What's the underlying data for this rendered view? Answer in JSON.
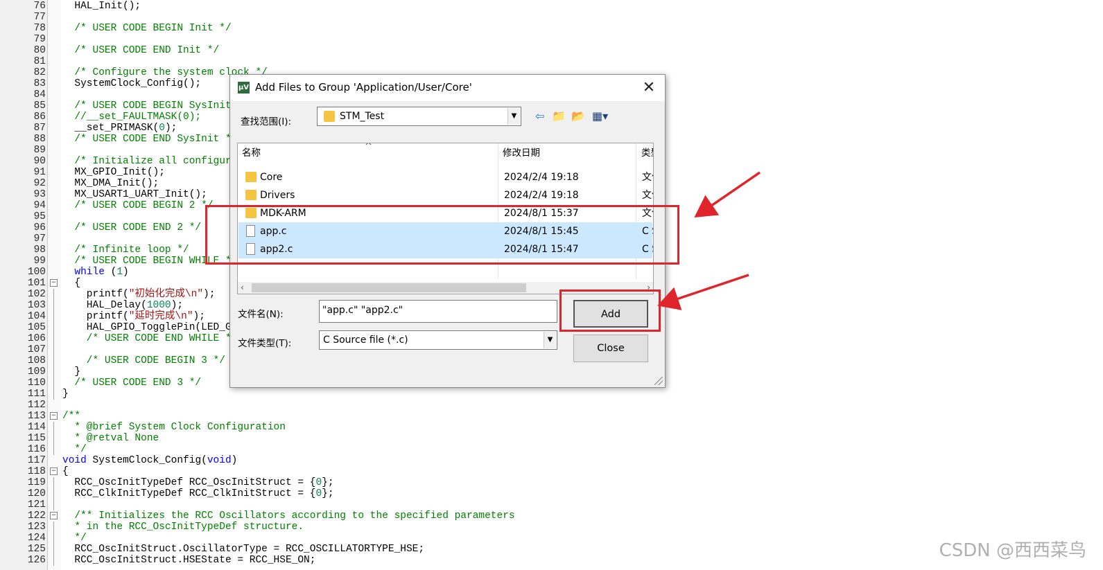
{
  "editor": {
    "lines": [
      {
        "n": "76",
        "fold": "",
        "segs": [
          {
            "t": "  HAL_Init();",
            "c": ""
          }
        ]
      },
      {
        "n": "77",
        "fold": "",
        "segs": []
      },
      {
        "n": "78",
        "fold": "",
        "segs": [
          {
            "t": "  /* USER CODE BEGIN Init */",
            "c": "cm"
          }
        ]
      },
      {
        "n": "79",
        "fold": "",
        "segs": []
      },
      {
        "n": "80",
        "fold": "",
        "segs": [
          {
            "t": "  /* USER CODE END Init */",
            "c": "cm"
          }
        ]
      },
      {
        "n": "81",
        "fold": "",
        "segs": []
      },
      {
        "n": "82",
        "fold": "",
        "segs": [
          {
            "t": "  /* Configure the system clock */",
            "c": "cm"
          }
        ]
      },
      {
        "n": "83",
        "fold": "",
        "segs": [
          {
            "t": "  SystemClock_Config();",
            "c": ""
          }
        ]
      },
      {
        "n": "84",
        "fold": "",
        "segs": []
      },
      {
        "n": "85",
        "fold": "",
        "segs": [
          {
            "t": "  /* USER CODE BEGIN SysInit */",
            "c": "cm"
          }
        ]
      },
      {
        "n": "86",
        "fold": "",
        "segs": [
          {
            "t": "  //__set_FAULTMASK(0);",
            "c": "cm"
          }
        ]
      },
      {
        "n": "87",
        "fold": "",
        "segs": [
          {
            "t": "  __set_PRIMASK(",
            "c": ""
          },
          {
            "t": "0",
            "c": "num"
          },
          {
            "t": ");",
            "c": ""
          }
        ]
      },
      {
        "n": "88",
        "fold": "",
        "segs": [
          {
            "t": "  /* USER CODE END SysInit */",
            "c": "cm"
          }
        ]
      },
      {
        "n": "89",
        "fold": "",
        "segs": []
      },
      {
        "n": "90",
        "fold": "",
        "segs": [
          {
            "t": "  /* Initialize all configured peripherals */",
            "c": "cm"
          }
        ]
      },
      {
        "n": "91",
        "fold": "",
        "segs": [
          {
            "t": "  MX_GPIO_Init();",
            "c": ""
          }
        ]
      },
      {
        "n": "92",
        "fold": "",
        "segs": [
          {
            "t": "  MX_DMA_Init();",
            "c": ""
          }
        ]
      },
      {
        "n": "93",
        "fold": "",
        "segs": [
          {
            "t": "  MX_USART1_UART_Init();",
            "c": ""
          }
        ]
      },
      {
        "n": "94",
        "fold": "",
        "segs": [
          {
            "t": "  /* USER CODE BEGIN 2 */",
            "c": "cm"
          }
        ]
      },
      {
        "n": "95",
        "fold": "",
        "segs": []
      },
      {
        "n": "96",
        "fold": "",
        "segs": [
          {
            "t": "  /* USER CODE END 2 */",
            "c": "cm"
          }
        ]
      },
      {
        "n": "97",
        "fold": "",
        "segs": []
      },
      {
        "n": "98",
        "fold": "",
        "segs": [
          {
            "t": "  /* Infinite loop */",
            "c": "cm"
          }
        ]
      },
      {
        "n": "99",
        "fold": "",
        "segs": [
          {
            "t": "  /* USER CODE BEGIN WHILE */",
            "c": "cm"
          }
        ]
      },
      {
        "n": "100",
        "fold": "",
        "segs": [
          {
            "t": "  ",
            "c": ""
          },
          {
            "t": "while",
            "c": "kw"
          },
          {
            "t": " (",
            "c": ""
          },
          {
            "t": "1",
            "c": "num"
          },
          {
            "t": ")",
            "c": ""
          }
        ]
      },
      {
        "n": "101",
        "fold": "box",
        "segs": [
          {
            "t": "  {",
            "c": ""
          }
        ]
      },
      {
        "n": "102",
        "fold": "line",
        "segs": [
          {
            "t": "    printf(",
            "c": ""
          },
          {
            "t": "\"初始化完成\\n\"",
            "c": "str"
          },
          {
            "t": ");",
            "c": ""
          }
        ]
      },
      {
        "n": "103",
        "fold": "line",
        "segs": [
          {
            "t": "    HAL_Delay(",
            "c": ""
          },
          {
            "t": "1000",
            "c": "num"
          },
          {
            "t": ");",
            "c": ""
          }
        ]
      },
      {
        "n": "104",
        "fold": "line",
        "segs": [
          {
            "t": "    printf(",
            "c": ""
          },
          {
            "t": "\"延时完成\\n\"",
            "c": "str"
          },
          {
            "t": ");",
            "c": ""
          }
        ]
      },
      {
        "n": "105",
        "fold": "line",
        "segs": [
          {
            "t": "    HAL_GPIO_TogglePin(LED_GPIO_Port, LED_Pin);",
            "c": ""
          }
        ]
      },
      {
        "n": "106",
        "fold": "line",
        "segs": [
          {
            "t": "    /* USER CODE END WHILE */",
            "c": "cm"
          }
        ]
      },
      {
        "n": "107",
        "fold": "line",
        "segs": []
      },
      {
        "n": "108",
        "fold": "line",
        "segs": [
          {
            "t": "    /* USER CODE BEGIN 3 */",
            "c": "cm"
          }
        ]
      },
      {
        "n": "109",
        "fold": "line",
        "segs": [
          {
            "t": "  }",
            "c": ""
          }
        ]
      },
      {
        "n": "110",
        "fold": "line",
        "segs": [
          {
            "t": "  /* USER CODE END 3 */",
            "c": "cm"
          }
        ]
      },
      {
        "n": "111",
        "fold": "line",
        "segs": [
          {
            "t": "}",
            "c": ""
          }
        ]
      },
      {
        "n": "112",
        "fold": "",
        "segs": []
      },
      {
        "n": "113",
        "fold": "box",
        "segs": [
          {
            "t": "/**",
            "c": "cm"
          }
        ]
      },
      {
        "n": "114",
        "fold": "line",
        "segs": [
          {
            "t": "  * @brief System Clock Configuration",
            "c": "cm"
          }
        ]
      },
      {
        "n": "115",
        "fold": "line",
        "segs": [
          {
            "t": "  * @retval None",
            "c": "cm"
          }
        ]
      },
      {
        "n": "116",
        "fold": "line",
        "segs": [
          {
            "t": "  */",
            "c": "cm"
          }
        ]
      },
      {
        "n": "117",
        "fold": "",
        "segs": [
          {
            "t": "void",
            "c": "kw"
          },
          {
            "t": " SystemClock_Config(",
            "c": ""
          },
          {
            "t": "void",
            "c": "kw"
          },
          {
            "t": ")",
            "c": ""
          }
        ]
      },
      {
        "n": "118",
        "fold": "box",
        "segs": [
          {
            "t": "{",
            "c": ""
          }
        ]
      },
      {
        "n": "119",
        "fold": "line",
        "segs": [
          {
            "t": "  RCC_OscInitTypeDef RCC_OscInitStruct = {",
            "c": ""
          },
          {
            "t": "0",
            "c": "num"
          },
          {
            "t": "};",
            "c": ""
          }
        ]
      },
      {
        "n": "120",
        "fold": "line",
        "segs": [
          {
            "t": "  RCC_ClkInitTypeDef RCC_ClkInitStruct = {",
            "c": ""
          },
          {
            "t": "0",
            "c": "num"
          },
          {
            "t": "};",
            "c": ""
          }
        ]
      },
      {
        "n": "121",
        "fold": "line",
        "segs": []
      },
      {
        "n": "122",
        "fold": "box",
        "segs": [
          {
            "t": "  /** Initializes the RCC Oscillators according to the specified parameters",
            "c": "cm"
          }
        ]
      },
      {
        "n": "123",
        "fold": "line",
        "segs": [
          {
            "t": "  * in the RCC_OscInitTypeDef structure.",
            "c": "cm"
          }
        ]
      },
      {
        "n": "124",
        "fold": "line",
        "segs": [
          {
            "t": "  */",
            "c": "cm"
          }
        ]
      },
      {
        "n": "125",
        "fold": "line",
        "segs": [
          {
            "t": "  RCC_OscInitStruct.OscillatorType = RCC_OSCILLATORTYPE_HSE;",
            "c": ""
          }
        ]
      },
      {
        "n": "126",
        "fold": "line",
        "segs": [
          {
            "t": "  RCC_OscInitStruct.HSEState = RCC_HSE_ON;",
            "c": ""
          }
        ]
      }
    ]
  },
  "dialog": {
    "title": "Add Files to Group 'Application/User/Core'",
    "app_icon": "keil-uvision-icon",
    "close_glyph": "✕",
    "look_in_label": "查找范围(I):",
    "look_in_value": "STM_Test",
    "toolbar": {
      "back_glyph": "⇦",
      "up_glyph": "📁",
      "new_folder_glyph": "📂",
      "view_glyph": "▦▾"
    },
    "columns": {
      "name": "名称",
      "modified": "修改日期",
      "type": "类型"
    },
    "sort_glyph": "^",
    "files": [
      {
        "name": "Core",
        "modified": "2024/2/4 19:18",
        "type": "文件夹",
        "kind": "folder",
        "selected": false
      },
      {
        "name": "Drivers",
        "modified": "2024/2/4 19:18",
        "type": "文件夹",
        "kind": "folder",
        "selected": false
      },
      {
        "name": "MDK-ARM",
        "modified": "2024/8/1 15:37",
        "type": "文件夹",
        "kind": "folder",
        "selected": false
      },
      {
        "name": "app.c",
        "modified": "2024/8/1 15:45",
        "type": "C Source",
        "kind": "file",
        "selected": true
      },
      {
        "name": "app2.c",
        "modified": "2024/8/1 15:47",
        "type": "C Source",
        "kind": "file",
        "selected": true
      }
    ],
    "filename_label": "文件名(N):",
    "filename_value": "\"app.c\" \"app2.c\"",
    "filetype_label": "文件类型(T):",
    "filetype_value": "C Source file (*.c)",
    "add_label": "Add",
    "close_label": "Close"
  },
  "annotation": {
    "color": "#e0242b"
  },
  "watermark": "CSDN @西西菜鸟"
}
